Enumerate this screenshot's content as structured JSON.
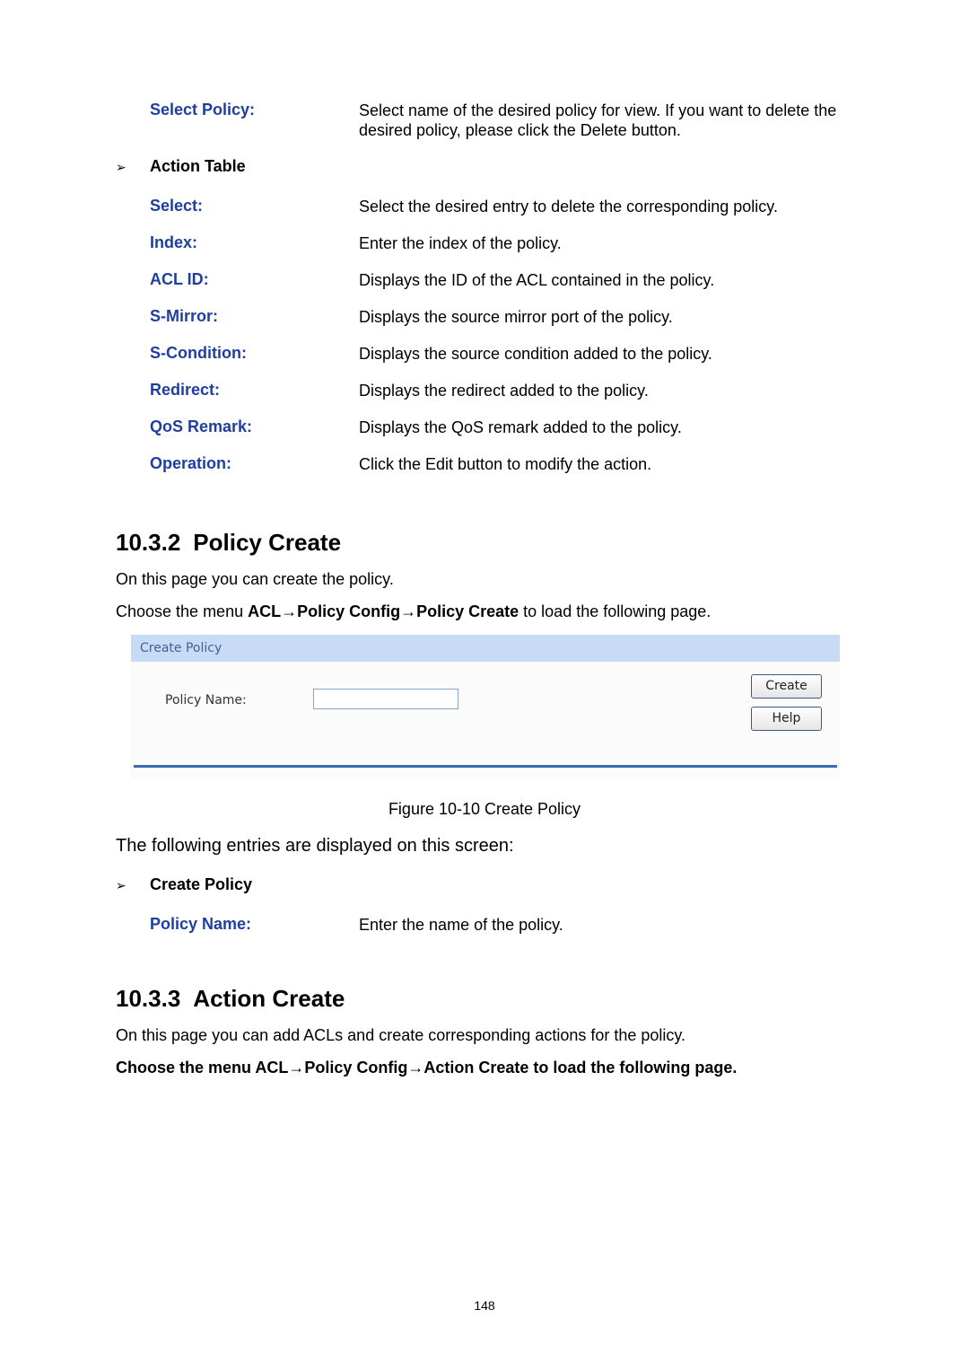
{
  "top_section": {
    "select_policy": {
      "term": "Select Policy:",
      "desc": "Select name of the desired policy for view. If you want to delete the desired policy, please click the Delete button."
    },
    "action_table": {
      "bullet": "➢",
      "title": "Action Table",
      "rows": [
        {
          "term": "Select:",
          "desc": "Select the desired entry to delete the corresponding policy."
        },
        {
          "term": "Index:",
          "desc": "Enter the index of the policy."
        },
        {
          "term": "ACL ID:",
          "desc": "Displays the ID of the ACL contained in the policy."
        },
        {
          "term": "S-Mirror:",
          "desc": "Displays the source mirror port of the policy."
        },
        {
          "term": "S-Condition:",
          "desc": "Displays the source condition added to the policy."
        },
        {
          "term": "Redirect:",
          "desc": "Displays the redirect added to the policy."
        },
        {
          "term": "QoS Remark:",
          "desc": "Displays the QoS remark added to the policy."
        },
        {
          "term": "Operation:",
          "desc": "Click the Edit button to modify the action."
        }
      ]
    }
  },
  "section_policy_create": {
    "number": "10.3.2",
    "title": "Policy Create",
    "intro": "On this page you can create the policy.",
    "menu_prefix": "Choose the menu ",
    "menu_path": "ACL→Policy Config→Policy Create",
    "menu_suffix": " to load the following page.",
    "figure": {
      "header": "Create Policy",
      "policy_name_label": "Policy Name:",
      "policy_name_value": "",
      "create_button": "Create",
      "help_button": "Help"
    },
    "caption": "Figure 10-10 Create Policy",
    "entries_lead": "The following entries are displayed on this screen:",
    "create_policy_group": {
      "bullet": "➢",
      "title": "Create Policy",
      "rows": [
        {
          "term": "Policy Name:",
          "desc": "Enter the name of the policy."
        }
      ]
    }
  },
  "section_action_create": {
    "number": "10.3.3",
    "title": "Action Create",
    "intro": "On this page you can add ACLs and create corresponding actions for the policy.",
    "menu_line": "Choose the menu ACL→Policy Config→Action Create to load the following page."
  },
  "colors": {
    "term": "#1f3fa0",
    "figure_header": "#c7dbf7",
    "figure_rule": "#3b6bb0"
  },
  "page_number": "148"
}
